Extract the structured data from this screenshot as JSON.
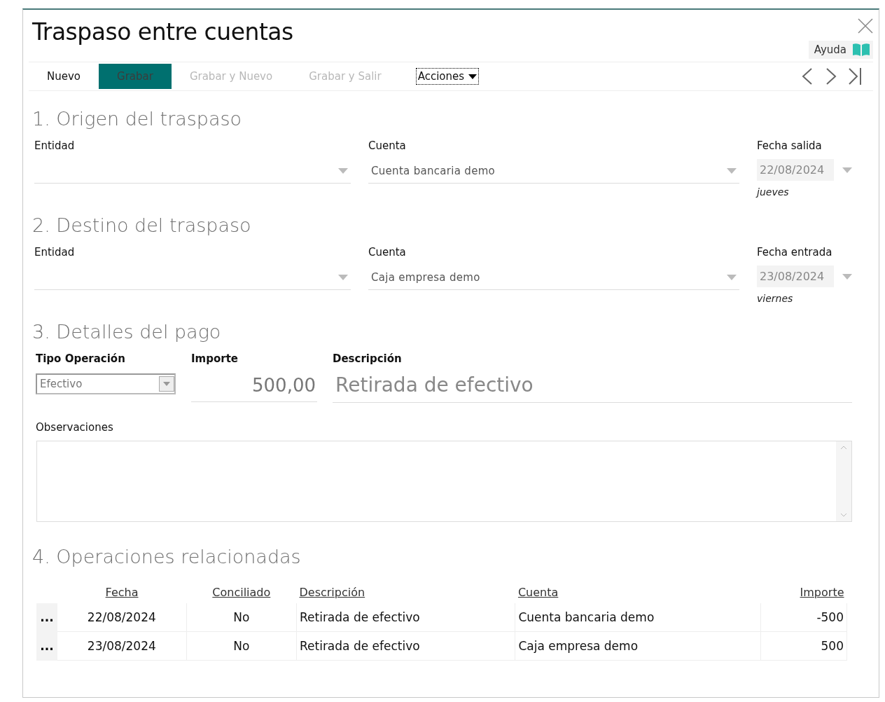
{
  "window": {
    "title": "Traspaso entre cuentas",
    "help": "Ayuda"
  },
  "toolbar": [
    {
      "label": "Nuevo",
      "kind": "normal",
      "disabled": false
    },
    {
      "label": "Grabar",
      "kind": "primary",
      "disabled": false
    },
    {
      "label": "Grabar y Nuevo",
      "kind": "normal",
      "disabled": true
    },
    {
      "label": "Grabar y Salir",
      "kind": "normal",
      "disabled": true
    },
    {
      "label": "Acciones",
      "kind": "menu",
      "disabled": false
    }
  ],
  "origin": {
    "heading": "1. Origen del traspaso",
    "entity_label": "Entidad",
    "account_label": "Cuenta",
    "account": "Cuenta bancaria demo",
    "date_label": "Fecha salida",
    "date": "22/08/2024",
    "weekday": "jueves"
  },
  "destination": {
    "heading": "2. Destino del traspaso",
    "entity_label": "Entidad",
    "account_label": "Cuenta",
    "account": "Caja empresa demo",
    "date_label": "Fecha entrada",
    "date": "23/08/2024",
    "weekday": "viernes"
  },
  "payment": {
    "heading": "3. Detalles del pago",
    "type_label": "Tipo Operación",
    "type": "Efectivo",
    "amount_label": "Importe",
    "amount": "500,00",
    "description_label": "Descripción",
    "description": "Retirada de efectivo",
    "notes_label": "Observaciones"
  },
  "related": {
    "heading": "4. Operaciones relacionadas",
    "columns": [
      "Fecha",
      "Conciliado",
      "Descripción",
      "Cuenta",
      "Importe"
    ],
    "rows": [
      {
        "menu": "...",
        "cells": [
          "22/08/2024",
          "No",
          "Retirada de efectivo",
          "Cuenta bancaria demo",
          "-500"
        ]
      },
      {
        "menu": "...",
        "cells": [
          "23/08/2024",
          "No",
          "Retirada de efectivo",
          "Caja empresa demo",
          "500"
        ]
      }
    ]
  }
}
